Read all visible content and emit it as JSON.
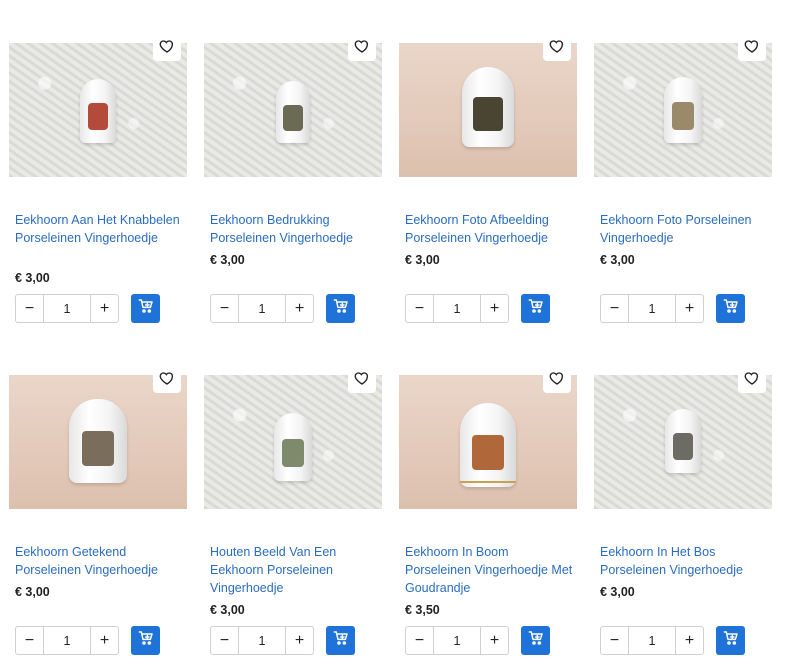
{
  "products": [
    {
      "title": "Eekhoorn Aan Het Knabbelen Porseleinen Vingerhoedje",
      "price": "€ 3,00",
      "qty": "1",
      "minus": "−",
      "plus": "+",
      "bg": "lace",
      "decal": "#b44a3a",
      "band": false
    },
    {
      "title": "Eekhoorn Bedrukking Porseleinen Vingerhoedje",
      "price": "€ 3,00",
      "qty": "1",
      "minus": "−",
      "plus": "+",
      "bg": "lace",
      "decal": "#6b6a55",
      "band": false
    },
    {
      "title": "Eekhoorn Foto Afbeelding Porseleinen Vingerhoedje",
      "price": "€ 3,00",
      "qty": "1",
      "minus": "−",
      "plus": "+",
      "bg": "pink",
      "decal": "#4a4533",
      "band": false
    },
    {
      "title": "Eekhoorn Foto Porseleinen Vingerhoedje",
      "price": "€ 3,00",
      "qty": "1",
      "minus": "−",
      "plus": "+",
      "bg": "lace",
      "decal": "#9a8a6a",
      "band": false
    },
    {
      "title": "Eekhoorn Getekend Porseleinen Vingerhoedje",
      "price": "€ 3,00",
      "qty": "1",
      "minus": "−",
      "plus": "+",
      "bg": "pink",
      "decal": "#7a6d5c",
      "band": false
    },
    {
      "title": "Houten Beeld Van Een Eekhoorn Porseleinen Vingerhoedje",
      "price": "€ 3,00",
      "qty": "1",
      "minus": "−",
      "plus": "+",
      "bg": "lace",
      "decal": "#7f8a6c",
      "band": false
    },
    {
      "title": "Eekhoorn In Boom Porseleinen Vingerhoedje Met Goudrandje",
      "price": "€ 3,50",
      "qty": "1",
      "minus": "−",
      "plus": "+",
      "bg": "pink",
      "decal": "#b0673a",
      "band": true
    },
    {
      "title": "Eekhoorn In Het Bos Porseleinen Vingerhoedje",
      "price": "€ 3,00",
      "qty": "1",
      "minus": "−",
      "plus": "+",
      "bg": "lace",
      "decal": "#6c6c64",
      "band": false
    }
  ],
  "icons": {
    "favorite": "heart-icon",
    "add_to_cart": "cart-plus-icon"
  },
  "colors": {
    "accent": "#1f72d8",
    "link": "#2a6cc0",
    "price": "#222222"
  }
}
